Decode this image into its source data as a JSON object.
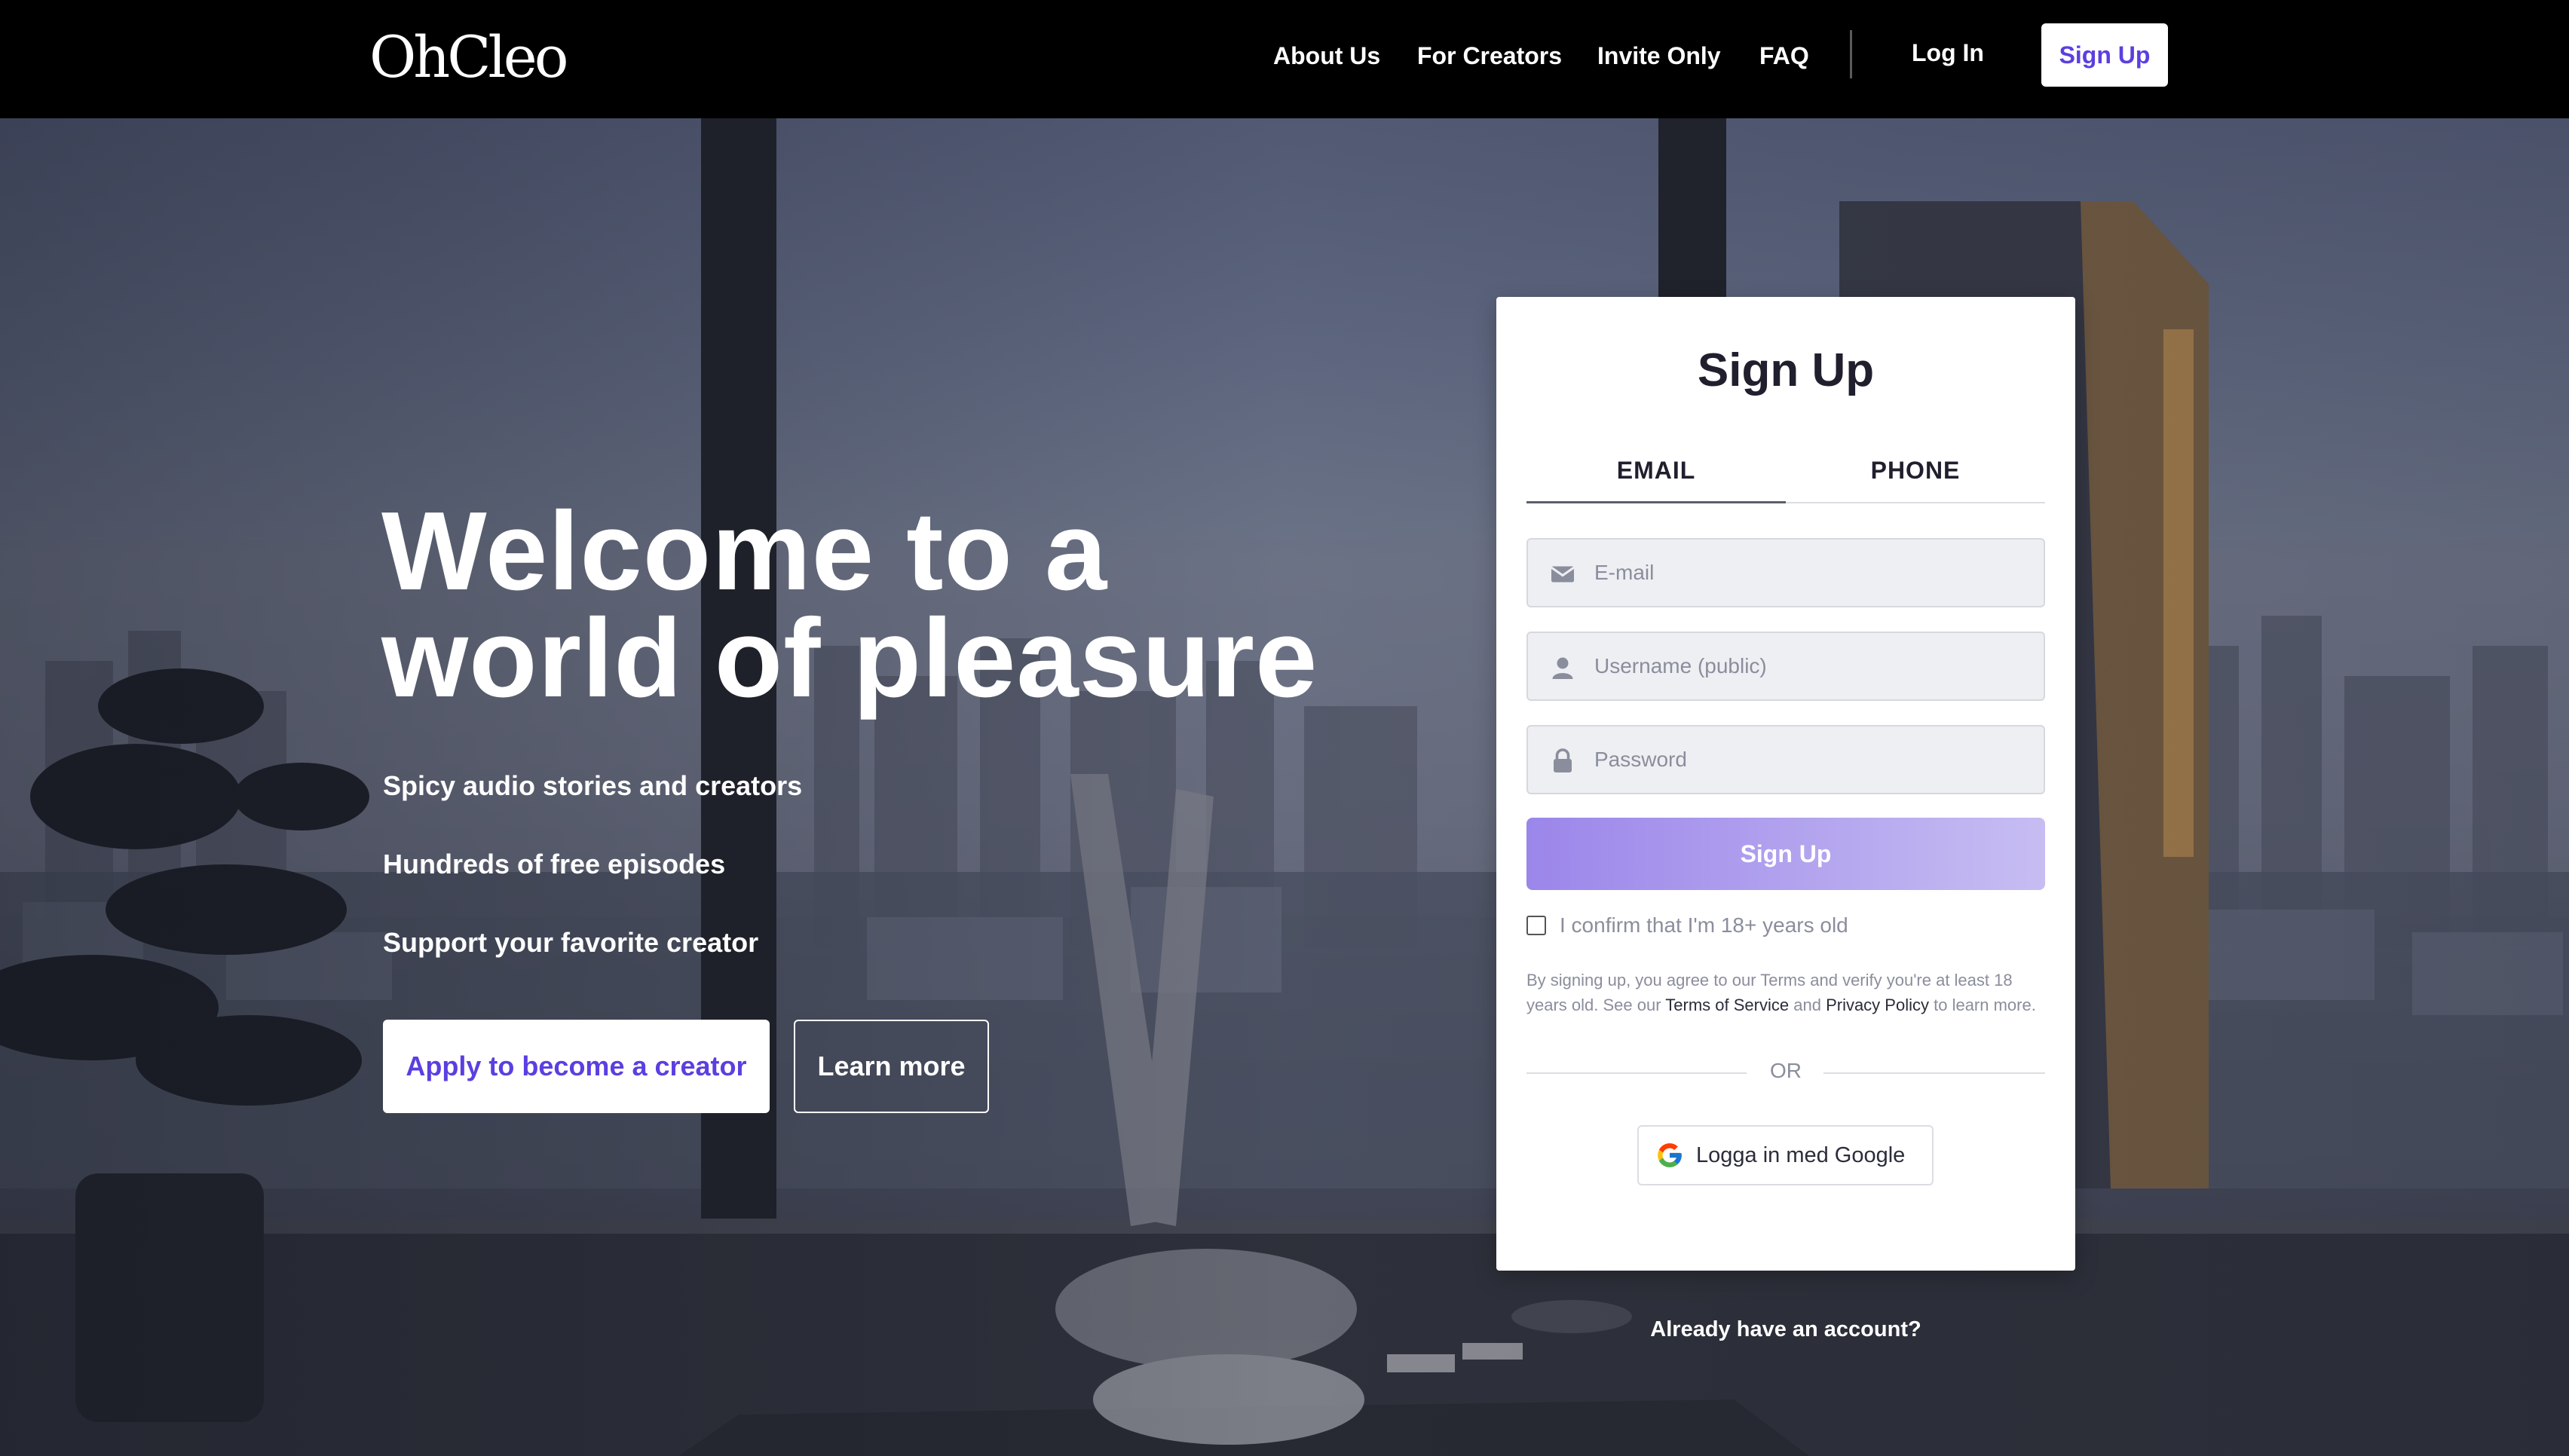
{
  "nav": {
    "logo": "OhCleo",
    "links": [
      {
        "label": "About Us"
      },
      {
        "label": "For Creators"
      },
      {
        "label": "Invite Only"
      },
      {
        "label": "FAQ"
      }
    ],
    "login_label": "Log In",
    "signup_label": "Sign Up"
  },
  "hero": {
    "headline_line1": "Welcome to a",
    "headline_line2": "world of pleasure",
    "features": [
      "Spicy audio stories and creators",
      "Hundreds of free episodes",
      "Support your favorite creator"
    ],
    "cta_primary": "Apply to become a creator",
    "cta_secondary": "Learn more"
  },
  "signup_card": {
    "title": "Sign Up",
    "tabs": [
      {
        "label": "EMAIL",
        "active": true
      },
      {
        "label": "PHONE",
        "active": false
      }
    ],
    "fields": [
      {
        "placeholder": "E-mail",
        "icon": "envelope-icon"
      },
      {
        "placeholder": "Username (public)",
        "icon": "user-icon"
      },
      {
        "placeholder": "Password",
        "icon": "lock-icon"
      }
    ],
    "submit_label": "Sign Up",
    "confirm_label": "I confirm that I'm 18+ years old",
    "confirm_checked": false,
    "legal_prefix": "By signing up, you agree to our Terms and verify you're at least 18 years old. See our",
    "terms_link": "Terms of Service",
    "legal_and": "and",
    "privacy_link": "Privacy Policy",
    "legal_suffix": "to learn more.",
    "or_label": "OR",
    "google_label": "Logga in med Google"
  },
  "already_account": "Already have an account?",
  "colors": {
    "brand_purple": "#5b3fe0",
    "button_gradient_start": "#9b86ea",
    "button_gradient_end": "#c7bdf2",
    "nav_background": "#000000"
  }
}
